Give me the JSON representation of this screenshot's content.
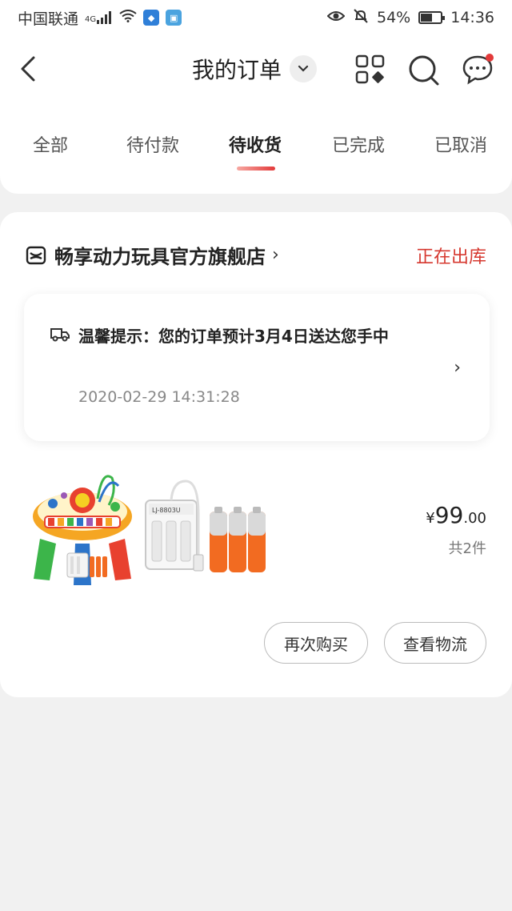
{
  "status_bar": {
    "carrier": "中国联通",
    "network": "4G",
    "battery": "54%",
    "battery_level": 0.54,
    "time": "14:36"
  },
  "header": {
    "title": "我的订单",
    "icons": [
      "back-icon",
      "chevron-down-icon",
      "apps-icon",
      "search-icon",
      "message-icon"
    ]
  },
  "tabs": [
    {
      "label": "全部"
    },
    {
      "label": "待付款"
    },
    {
      "label": "待收货"
    },
    {
      "label": "已完成"
    },
    {
      "label": "已取消"
    }
  ],
  "active_tab": "待收货",
  "order": {
    "shop_name": "畅享动力玩具官方旗舰店",
    "shop_chevron": "›",
    "status": "正在出库",
    "tip": {
      "text": "温馨提示：您的订单预计3月4日送达您手中",
      "time": "2020-02-29 14:31:28",
      "chevron": "›"
    },
    "product": {
      "price_currency": "¥",
      "price_integer": "99",
      "price_decimal": ".00",
      "quantity": "共2件",
      "battery_label": "LJ-8803U"
    },
    "buttons": {
      "rebuy": "再次购买",
      "logistics": "查看物流"
    }
  },
  "colors": {
    "accent": "#d6382f",
    "background": "#f1f1f1"
  }
}
